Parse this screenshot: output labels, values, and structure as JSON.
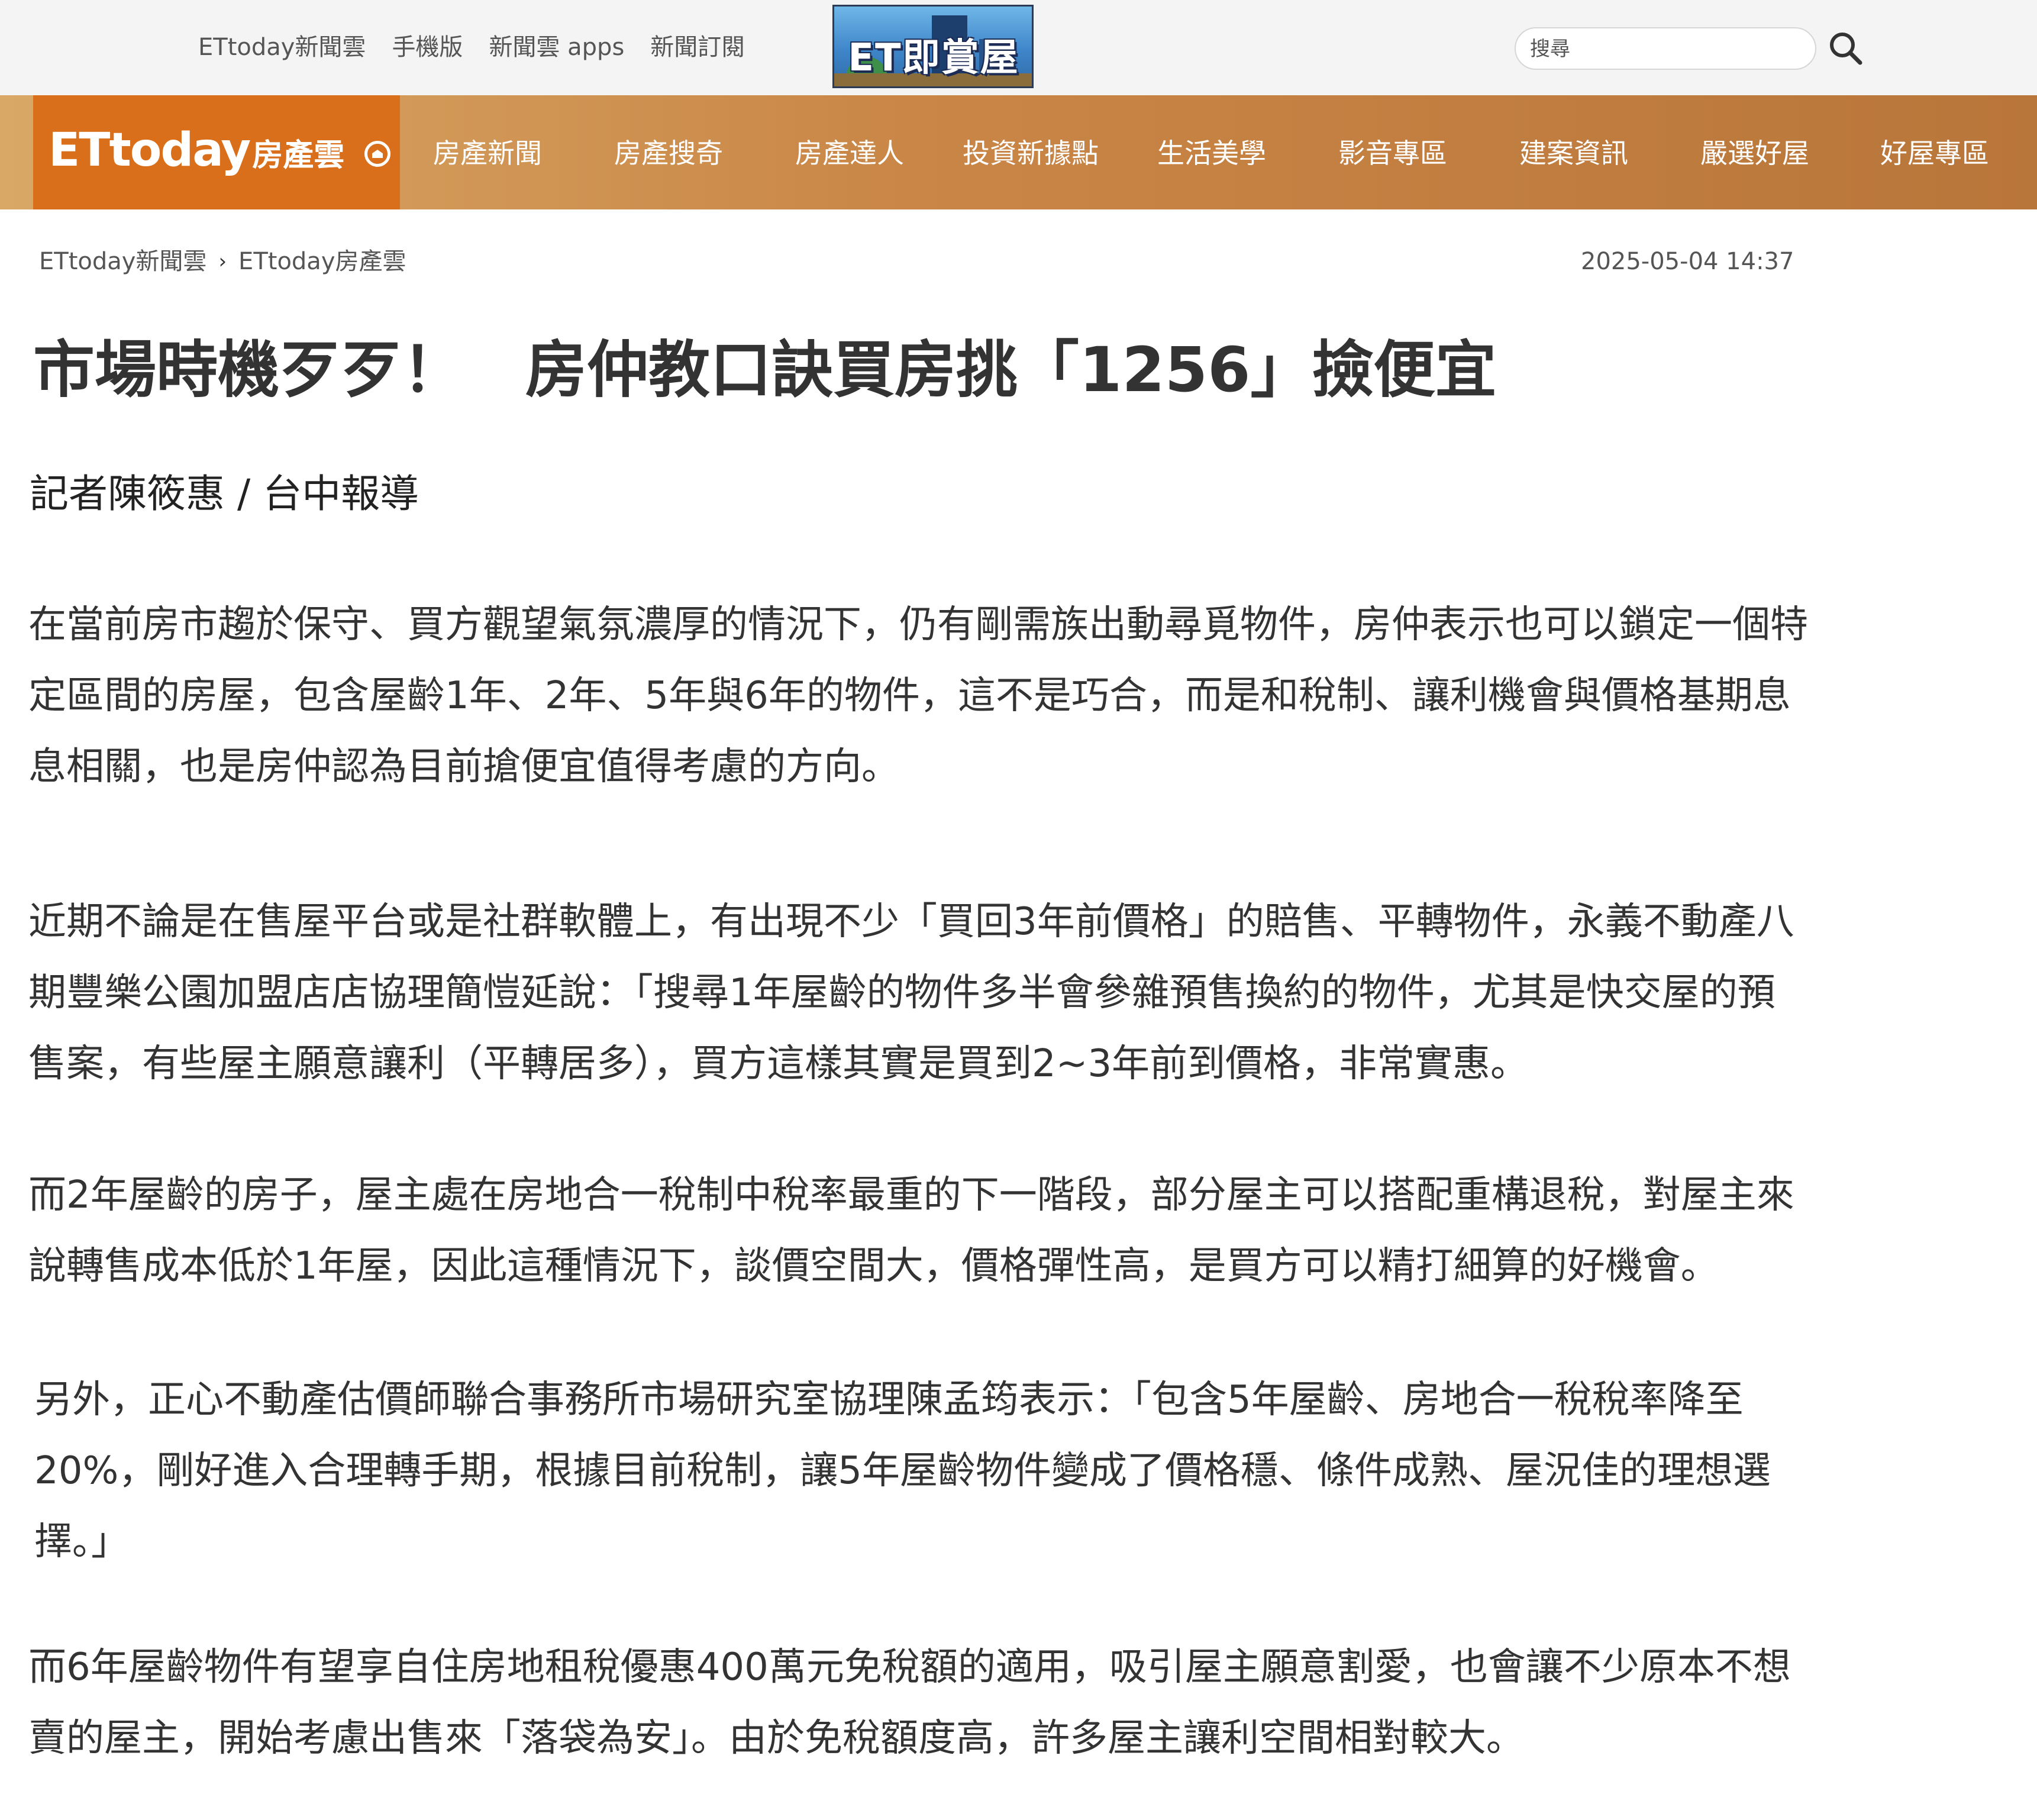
{
  "topbar": {
    "links": [
      "ETtoday新聞雲",
      "手機版",
      "新聞雲 apps",
      "新聞訂閱"
    ],
    "center_logo_text": "ET即賞屋",
    "search_placeholder": "搜尋"
  },
  "nav": {
    "brand": "ETtoday",
    "brand_sub": "房產雲",
    "items": [
      "房產新聞",
      "房產搜奇",
      "房產達人",
      "投資新據點",
      "生活美學",
      "影音專區",
      "建案資訊",
      "嚴選好屋",
      "好屋專區"
    ]
  },
  "breadcrumb": {
    "items": [
      "ETtoday新聞雲",
      "ETtoday房產雲"
    ],
    "separator": "›"
  },
  "article": {
    "timestamp": "2025-05-04 14:37",
    "headline": "市場時機歹歹！　房仲教口訣買房挑「1256」撿便宜",
    "byline": "記者陳筱惠 / 台中報導",
    "paragraphs": [
      [
        "在當前房市趨於保守、買方觀望氣氛濃厚的情況下，仍有剛需族出動尋覓物件，房仲表示也可以鎖定一個特",
        "定區間的房屋，包含屋齡1年、2年、5年與6年的物件，這不是巧合，而是和稅制、讓利機會與價格基期息",
        "息相關，也是房仲認為目前搶便宜值得考慮的方向。"
      ],
      [
        "近期不論是在售屋平台或是社群軟體上，有出現不少「買回3年前價格」的賠售、平轉物件，永義不動產八",
        "期豐樂公園加盟店店協理簡愷延說：「搜尋1年屋齡的物件多半會參雜預售換約的物件，尤其是快交屋的預",
        "售案，有些屋主願意讓利（平轉居多），買方這樣其實是買到2~3年前到價格，非常實惠。"
      ],
      [
        "而2年屋齡的房子，屋主處在房地合一稅制中稅率最重的下一階段，部分屋主可以搭配重構退稅，對屋主來",
        "說轉售成本低於1年屋，因此這種情況下，談價空間大，價格彈性高，是買方可以精打細算的好機會。"
      ],
      [
        "另外，正心不動產估價師聯合事務所市場研究室協理陳孟筠表示：「包含5年屋齡、房地合一稅稅率降至",
        "20%，剛好進入合理轉手期，根據目前稅制，讓5年屋齡物件變成了價格穩、條件成熟、屋況佳的理想選",
        "擇。」"
      ],
      [
        "而6年屋齡物件有望享自住房地租稅優惠400萬元免稅額的適用，吸引屋主願意割愛，也會讓不少原本不想",
        "賣的屋主，開始考慮出售來「落袋為安」。由於免稅額度高，許多屋主讓利空間相對較大。"
      ]
    ]
  },
  "colors": {
    "topbar_bg": "#f4f4f4",
    "brand_orange": "#d96f1a",
    "nav_gradient_start": "#d9a866",
    "nav_gradient_end": "#b9763a",
    "text": "#333333"
  }
}
